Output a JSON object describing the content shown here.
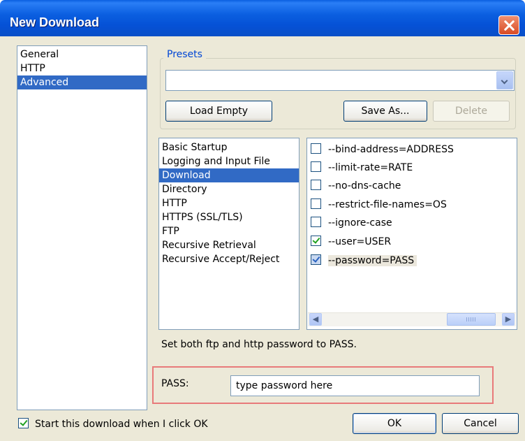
{
  "window": {
    "title": "New Download"
  },
  "categories": {
    "items": [
      {
        "label": "General",
        "selected": false
      },
      {
        "label": "HTTP",
        "selected": false
      },
      {
        "label": "Advanced",
        "selected": true
      }
    ]
  },
  "presets": {
    "legend": "Presets",
    "selected_value": "",
    "load_empty_label": "Load Empty",
    "save_as_label": "Save As...",
    "delete_label": "Delete"
  },
  "sections": {
    "items": [
      {
        "label": "Basic Startup",
        "selected": false
      },
      {
        "label": "Logging and Input File",
        "selected": false
      },
      {
        "label": "Download",
        "selected": true
      },
      {
        "label": "Directory",
        "selected": false
      },
      {
        "label": "HTTP",
        "selected": false
      },
      {
        "label": "HTTPS (SSL/TLS)",
        "selected": false
      },
      {
        "label": "FTP",
        "selected": false
      },
      {
        "label": "Recursive Retrieval",
        "selected": false
      },
      {
        "label": "Recursive Accept/Reject",
        "selected": false
      }
    ]
  },
  "options": {
    "items": [
      {
        "label": "--bind-address=ADDRESS",
        "checked": false,
        "selected": false
      },
      {
        "label": "--limit-rate=RATE",
        "checked": false,
        "selected": false
      },
      {
        "label": "--no-dns-cache",
        "checked": false,
        "selected": false
      },
      {
        "label": "--restrict-file-names=OS",
        "checked": false,
        "selected": false
      },
      {
        "label": "--ignore-case",
        "checked": false,
        "selected": false
      },
      {
        "label": "--user=USER",
        "checked": true,
        "selected": false
      },
      {
        "label": "--password=PASS",
        "checked": true,
        "selected": true
      }
    ]
  },
  "description": "Set both ftp and http password to PASS.",
  "pass_field": {
    "label": "PASS:",
    "value": "type password here"
  },
  "footer": {
    "start_checkbox_label": "Start this download when I click OK",
    "start_checked": true,
    "ok_label": "OK",
    "cancel_label": "Cancel"
  },
  "icons": {
    "close": "close-icon",
    "dropdown": "chevron-down-icon",
    "scroll_left": "arrow-left-icon",
    "scroll_right": "arrow-right-icon"
  },
  "colors": {
    "titlebar": "#0551d6",
    "selection": "#316ac5",
    "legend": "#0046d5",
    "highlight_frame": "#e87a7a",
    "dialog_bg": "#ece9d8"
  }
}
